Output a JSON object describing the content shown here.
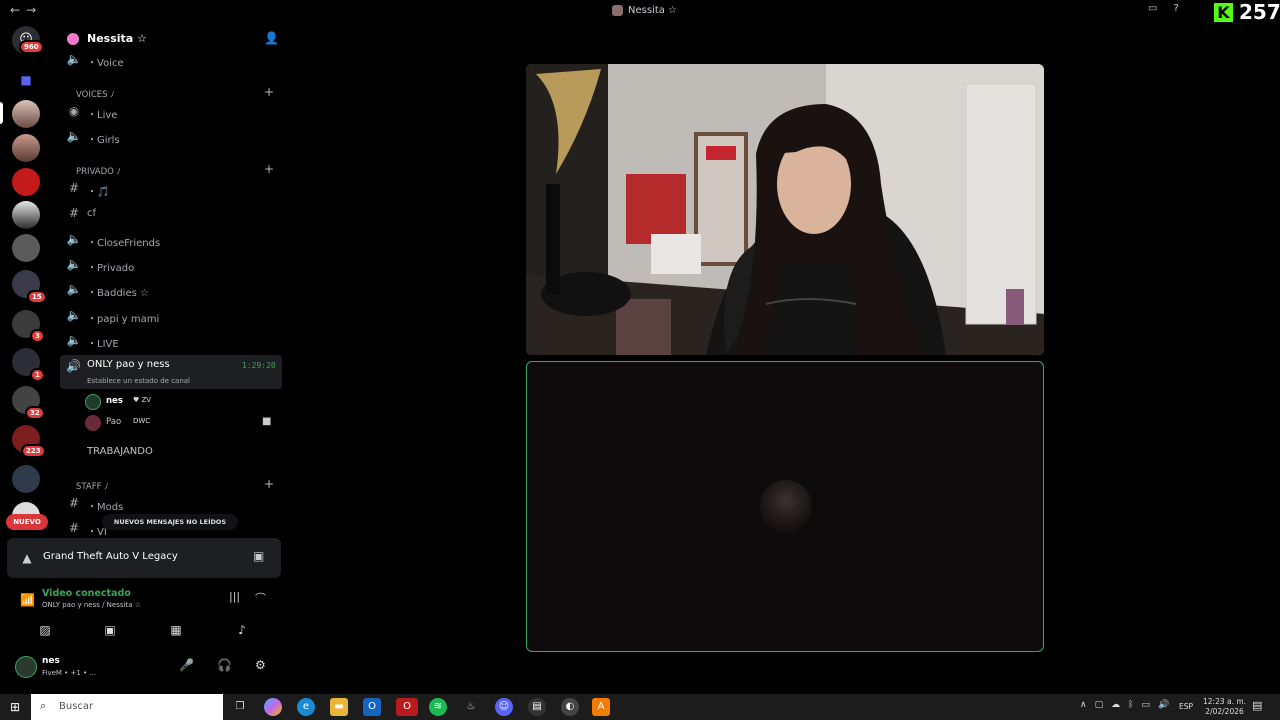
{
  "window": {
    "title": "Nessita ☆",
    "back_icon": "arrow-left-icon",
    "forward_icon": "arrow-right-icon"
  },
  "kick": {
    "count": "257"
  },
  "guild_bar": {
    "home_badge": "960",
    "badges": [
      {
        "count": "15"
      },
      {
        "count": "3"
      },
      {
        "count": "1"
      },
      {
        "count": "32"
      },
      {
        "count": "223"
      }
    ],
    "new_label": "NUEVO"
  },
  "server": {
    "name": "Nessita ☆"
  },
  "channels": {
    "voice_top": "・Voice",
    "cat_voices": "VOICES ﾉ",
    "live": "・Live",
    "girls": "・Girls",
    "cat_privado": "PRIVADO ﾉ",
    "music": "・🎵",
    "cf": "cf",
    "closefriends": "・CloseFriends",
    "privado": "・Privado",
    "baddies": "・Baddies ☆",
    "papi": "・papi y mami",
    "live2": "・LIVE",
    "active": {
      "name": "ONLY pao y ness",
      "time": "1:29:20",
      "status": "Establece un estado de canal"
    },
    "members": [
      {
        "name": "nes",
        "tag": "♥ ZV"
      },
      {
        "name": "Pao",
        "tag": "DWC"
      }
    ],
    "trabajando": "TRABAJANDO",
    "cat_staff": "STAFF ﾉ",
    "mods": "・Mods",
    "vip": "・VI"
  },
  "new_messages": "NUEVOS MENSAJES NO LEÍDOS",
  "game": {
    "name": "Grand Theft Auto V Legacy"
  },
  "voice": {
    "status": "Video conectado",
    "channel": "ONLY pao y ness / Nessita ☆"
  },
  "user": {
    "name": "nes",
    "activity": "FiveM • +1 • ..."
  },
  "taskbar": {
    "search": "Buscar",
    "lang": "ESP",
    "time": "12:23 a. m.",
    "date": "2/02/2026",
    "notif_count": "4"
  }
}
